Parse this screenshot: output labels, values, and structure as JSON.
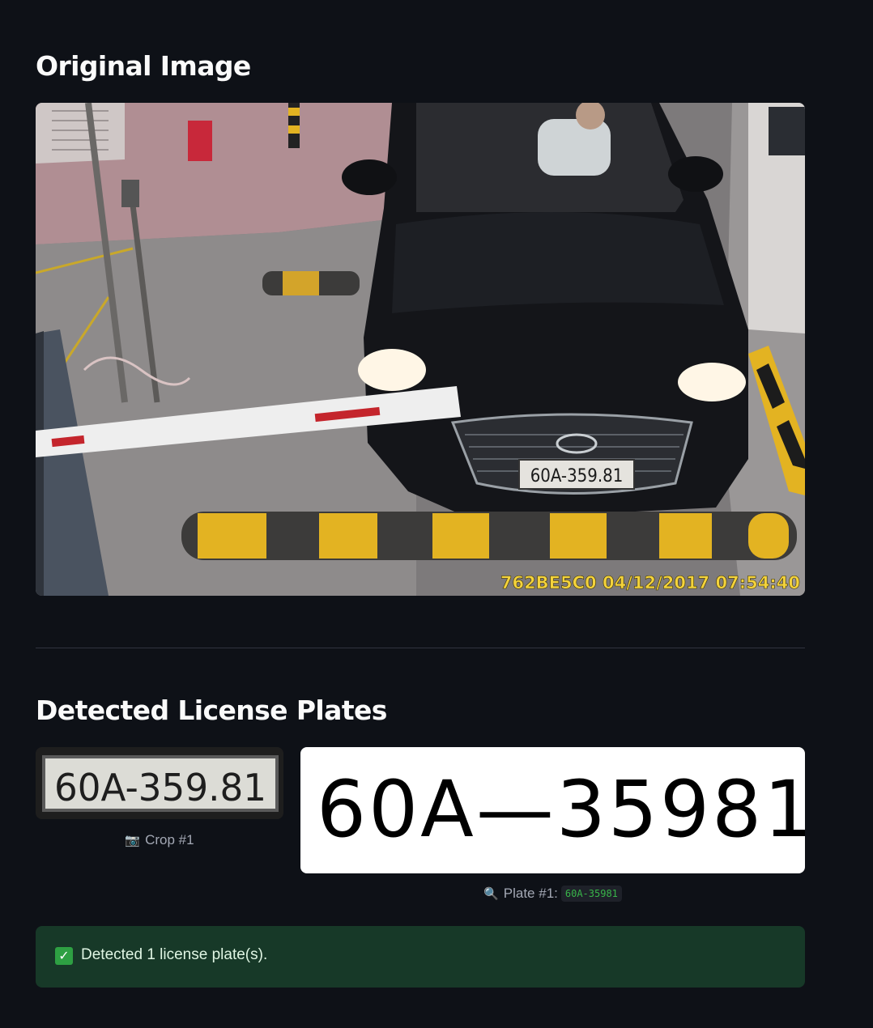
{
  "sections": {
    "original_title": "Original Image",
    "detected_title": "Detected License Plates"
  },
  "original_image": {
    "plate_text": "60A-359.81",
    "camera_overlay": "762BE5C0  04/12/2017 07:54:40",
    "colors": {
      "car": "#141519",
      "floor": "#8c8a8a",
      "wall": "#b08e93",
      "stripe_yellow": "#e3b322",
      "overlay_text": "#f4d33c"
    }
  },
  "crop": {
    "plate_text": "60A-359.81",
    "caption_icon": "camera-icon",
    "caption": "Crop #1"
  },
  "plate_result": {
    "rendered_text": "60A—35981",
    "caption_icon": "magnifier-icon",
    "caption_label": "Plate #1:",
    "code": "60A-35981"
  },
  "alert": {
    "icon": "checkmark-icon",
    "text": "Detected 1 license plate(s).",
    "colors": {
      "background": "#173928",
      "icon": "#2ea043"
    }
  },
  "theme": {
    "background": "#0e1117",
    "text": "#fafafa",
    "caption": "#a3a8b4",
    "code_text": "#38b449"
  }
}
